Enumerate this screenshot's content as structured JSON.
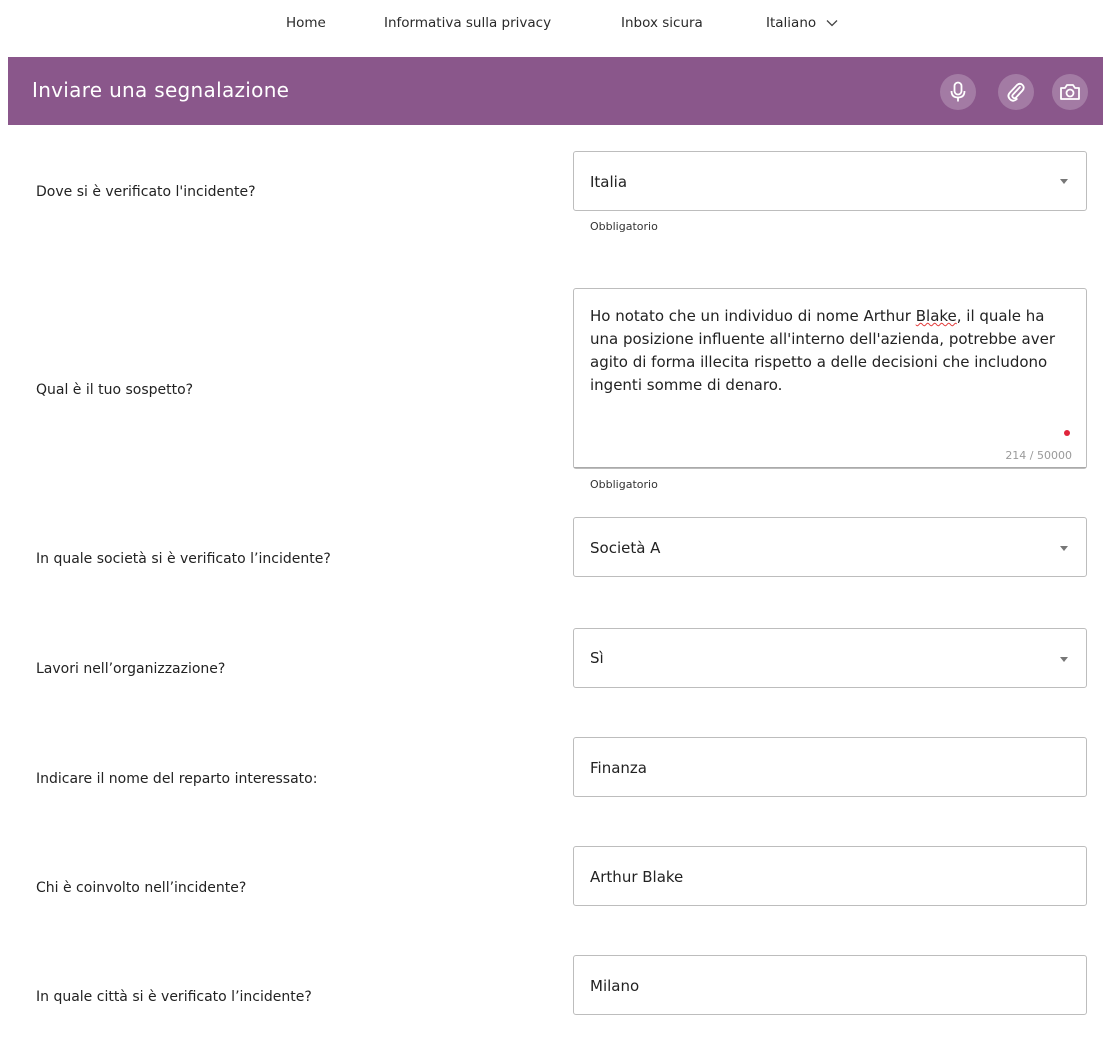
{
  "nav": {
    "home": "Home",
    "privacy": "Informativa sulla privacy",
    "inbox": "Inbox sicura",
    "language": "Italiano"
  },
  "header": {
    "title": "Inviare una segnalazione",
    "icons": [
      "microphone-icon",
      "paperclip-icon",
      "camera-icon"
    ],
    "background": "#8a578b"
  },
  "form": {
    "location": {
      "label": "Dove si è verificato l'incidente?",
      "value": "Italia",
      "hint": "Obbligatorio"
    },
    "suspicion": {
      "label": "Qual è il tuo sospetto?",
      "text_before": "Ho notato che un individuo di nome Arthur ",
      "text_misspelled": "Blake",
      "text_after": ", il quale ha una posizione influente all'interno dell'azienda, potrebbe aver agito di forma illecita rispetto a delle decisioni che includono ingenti somme di denaro.",
      "counter": "214 / 50000",
      "hint": "Obbligatorio"
    },
    "company": {
      "label": "In quale società si è verificato l’incidente?",
      "value": "Società A"
    },
    "works": {
      "label": "Lavori nell’organizzazione?",
      "value": "Sì"
    },
    "department": {
      "label": "Indicare il nome del reparto interessato:",
      "value": "Finanza"
    },
    "involved": {
      "label": "Chi è coinvolto nell’incidente?",
      "value": "Arthur Blake"
    },
    "city": {
      "label": "In quale città si è verificato l’incidente?",
      "value": "Milano"
    }
  }
}
